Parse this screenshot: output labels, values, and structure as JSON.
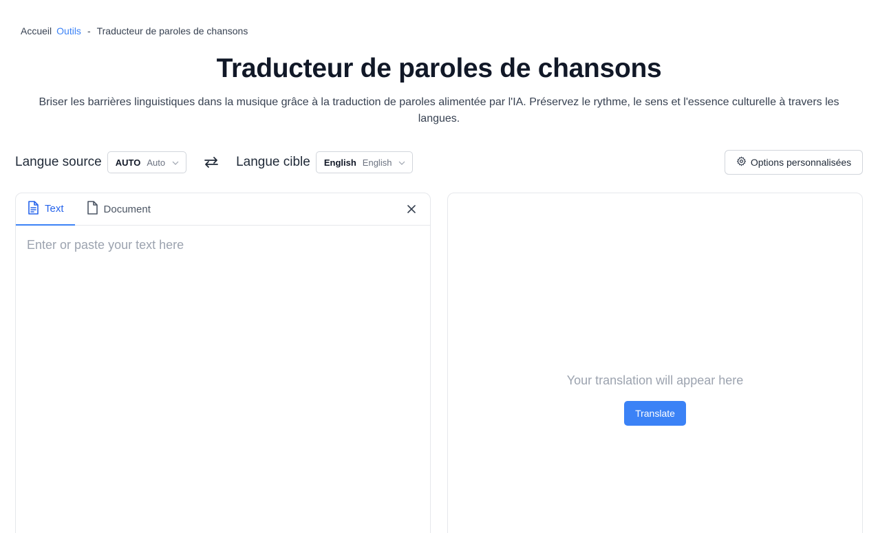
{
  "breadcrumb": {
    "home": "Accueil",
    "tools": "Outils",
    "separator": "-",
    "current": "Traducteur de paroles de chansons"
  },
  "header": {
    "title": "Traducteur de paroles de chansons",
    "subtitle": "Briser les barrières linguistiques dans la musique grâce à la traduction de paroles alimentée par l'IA. Préservez le rythme, le sens et l'essence culturelle à travers les langues."
  },
  "language_bar": {
    "source_label": "Langue source",
    "source": {
      "code": "AUTO",
      "name": "Auto"
    },
    "target_label": "Langue cible",
    "target": {
      "code": "English",
      "name": "English"
    },
    "options_label": "Options personnalisées"
  },
  "input_panel": {
    "tabs": [
      {
        "label": "Text",
        "icon": "file-text-icon",
        "active": true
      },
      {
        "label": "Document",
        "icon": "file-icon",
        "active": false
      }
    ],
    "placeholder": "Enter or paste your text here",
    "value": ""
  },
  "output_panel": {
    "placeholder": "Your translation will appear here",
    "translate_label": "Translate"
  },
  "colors": {
    "accent": "#3b82f6",
    "accent_text": "#2563eb",
    "border": "#e5e7eb",
    "placeholder": "#9ca3af"
  }
}
